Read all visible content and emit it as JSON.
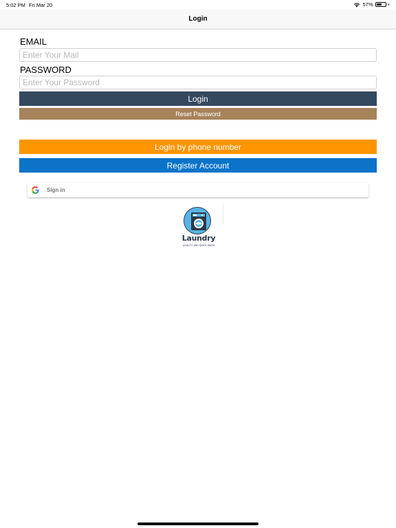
{
  "status_bar": {
    "time": "5:02 PM",
    "date": "Fri Mar 20",
    "battery_text": "57%",
    "battery_level": 0.57
  },
  "nav": {
    "title": "Login"
  },
  "form": {
    "email_label": "EMAIL",
    "email_placeholder": "Enter Your Mail",
    "email_value": "",
    "password_label": "PASSWORD",
    "password_placeholder": "Enter Your Password",
    "password_value": "",
    "login_button": "Login",
    "reset_button": "Reset Password"
  },
  "alt_actions": {
    "phone_login_button": "Login by phone number",
    "register_button": "Register Account",
    "google_signin_label": "Sign in"
  },
  "logo": {
    "brand": "Laundry",
    "tagline": "QUALITY AND QUICK WASH"
  },
  "colors": {
    "login_button": "#34495e",
    "reset_button": "#a6835a",
    "phone_button": "#ff9500",
    "register_button": "#0a74c9",
    "logo_blue": "#58b5e6",
    "logo_dark": "#2b3a4a"
  },
  "icons": {
    "wifi": "wifi-icon",
    "battery": "battery-icon",
    "google": "google-icon",
    "logo": "washing-machine-icon"
  }
}
